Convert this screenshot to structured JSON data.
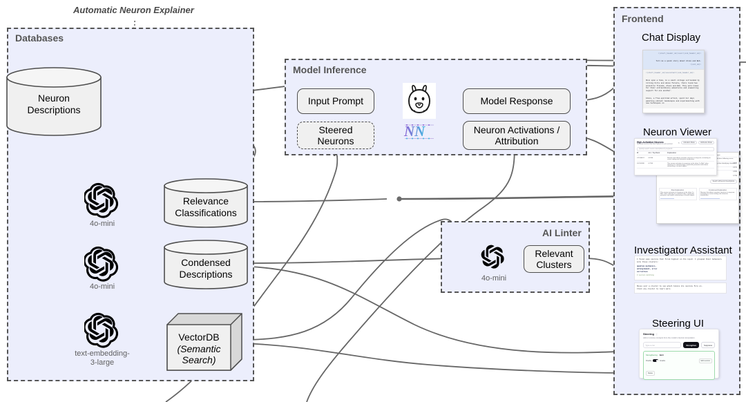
{
  "diagram": {
    "floating_title": "Automatic Neuron Explainer",
    "panels": {
      "databases": {
        "title": "Databases"
      },
      "model_inference": {
        "title": "Model Inference"
      },
      "ai_linter": {
        "title": "AI Linter"
      },
      "frontend": {
        "title": "Frontend"
      }
    },
    "nodes": {
      "neuron_descriptions": "Neuron\nDescriptions",
      "relevance_classifications": "Relevance\nClassifications",
      "condensed_descriptions": "Condensed\nDescriptions",
      "vectordb_line1": "VectorDB",
      "vectordb_line2": "(Semantic",
      "vectordb_line3": "Search)",
      "input_prompt": "Input Prompt",
      "steered_neurons": "Steered\nNeurons",
      "model_response": "Model Response",
      "neuron_activations": "Neuron Activations /\nAttribution",
      "relevant_clusters": "Relevant\nClusters"
    },
    "model_captions": {
      "gpt_mini_1": "4o-mini",
      "gpt_mini_2": "4o-mini",
      "embedding": "text-embedding-\n3-large",
      "gpt_mini_linter": "4o-mini"
    },
    "logo_names": {
      "openai": "openai-logo",
      "llama": "llama-logo",
      "nnsight": "nnsight-logo"
    }
  },
  "frontend": {
    "sections": [
      {
        "title": "Chat Display"
      },
      {
        "title": "Neuron Viewer"
      },
      {
        "title": "Investigator Assistant"
      },
      {
        "title": "Steering UI"
      }
    ],
    "chat_display": {
      "user_header": "<|start_header_id|>user<|end_header_id|>",
      "user_message": "Tell me a quick story about Alice and Bob.",
      "user_eot": "<|eot_id|>",
      "assistant_header": "<|start_header_id|>assistant<|end_header_id|>",
      "assistant_p1": "Once upon a time, in a small village surrounded by rolling hills and dense forests, there lived two eccentric friends, Alice and Bob. They were known for their extraordinary adventures and unwavering support for one another.",
      "assistant_p2": "Alice, a free-spirited artist, spent her days painting vibrant landscapes and experimenting with new techniques in"
    },
    "neuron_viewer": {
      "panel_title": "High-Activation Neurons",
      "panel_subtitle": "Showing neurons that fired highest on your prompt.",
      "search_placeholder": "Quickly search neuron descriptions by keyword...",
      "mode_buttons": [
        "Activation Mode",
        "Attribution Mode"
      ],
      "columns": [
        "ID",
        "Act. / Top Rank",
        "Explanation"
      ],
      "rows": [
        {
          "id": "L25 N4374",
          "score": "0.8746",
          "explanation": "Neurons that detect narrative structure in story text, activating on scene-setting and character introduction."
        },
        {
          "id": "L18 N1188",
          "score": "0.7205",
          "explanation": "This neuron activates its response to the token \"to Bob\" when referring to a named entity, in particular pronouns and names referencing a second subject."
        }
      ],
      "detail_lines": [
        "Detects references to proper names appearing after conversational turn markers in dialogue.",
        "Pattern: \"Alice\" and \"Bob\" in narrative contexts; often co-occurs with named-entity introductions following scene-setting.",
        "Fires on tokens that introduce, e.g. a first-person-singular narrator in context, processing when identifying character mentions in prose.",
        "Pattern: Named entity"
      ],
      "detail_scores": [
        "0.893",
        "0.871",
        "0.853",
        "0.792",
        "0.741"
      ],
      "sub_panels": [
        "Raw Explanation",
        "Condensed Explanation"
      ],
      "footer_link": "Search all Neuron Descriptions"
    },
    "investigator_assistant": {
      "intro": "I found some neurons that fired highest on the input. I grouped their behaviors into these clusters:",
      "clusters": [
        "quantum mechanics,",
        "entanglement, error",
        "correction"
      ],
      "meta": "3 neurons matching",
      "hint_line1": "Mouse over a cluster to see which tokens its neurons fire on.",
      "hint_line2": "Click any cluster to learn more."
    },
    "steering_ui": {
      "title": "Steering",
      "subtitle": "Add or remove concepts from the model's internal computation.",
      "input_placeholder": "Type a con",
      "btn_strengthen": "Strengthen",
      "btn_suppress": "Suppress",
      "active_mode": "Strengthening",
      "active_concept": "bird",
      "toggle_left": "Disable",
      "toggle_right": "Enable",
      "edit_button": "Edit neurons",
      "delete_button": "Delete"
    }
  },
  "colors": {
    "panel_bg": "#eceefc",
    "panel_border": "#555555",
    "node_fill": "#f0f0f0",
    "node_border": "#4d4d4d",
    "edge": "#666666",
    "caption": "#5f5f5f"
  }
}
